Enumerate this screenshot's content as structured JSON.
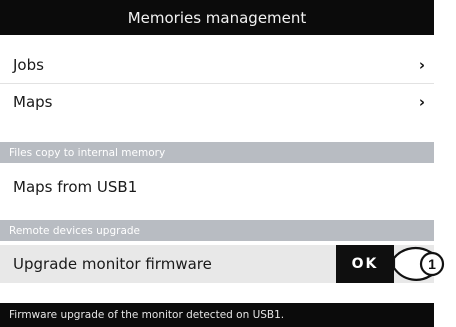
{
  "header": {
    "title": "Memories management"
  },
  "menu": {
    "jobs_label": "Jobs",
    "maps_label": "Maps",
    "chevron": "›"
  },
  "sections": {
    "files_copy_header": "Files copy to internal memory",
    "maps_from_usb_label": "Maps from USB1",
    "remote_upgrade_header": "Remote devices upgrade",
    "upgrade_monitor_label": "Upgrade monitor firmware",
    "ok_label": "OK"
  },
  "callout": {
    "number": "1"
  },
  "status": {
    "message": "Firmware upgrade of the monitor detected on USB1."
  },
  "colors": {
    "bar_background": "#0b0b0b",
    "section_header_background": "#b8bcc2",
    "selected_row_background": "#e8e8e8",
    "ok_button_background": "#0f0f0f"
  },
  "icons": {
    "jobs_arrow": "chevron-right-icon",
    "maps_arrow": "chevron-right-icon"
  }
}
